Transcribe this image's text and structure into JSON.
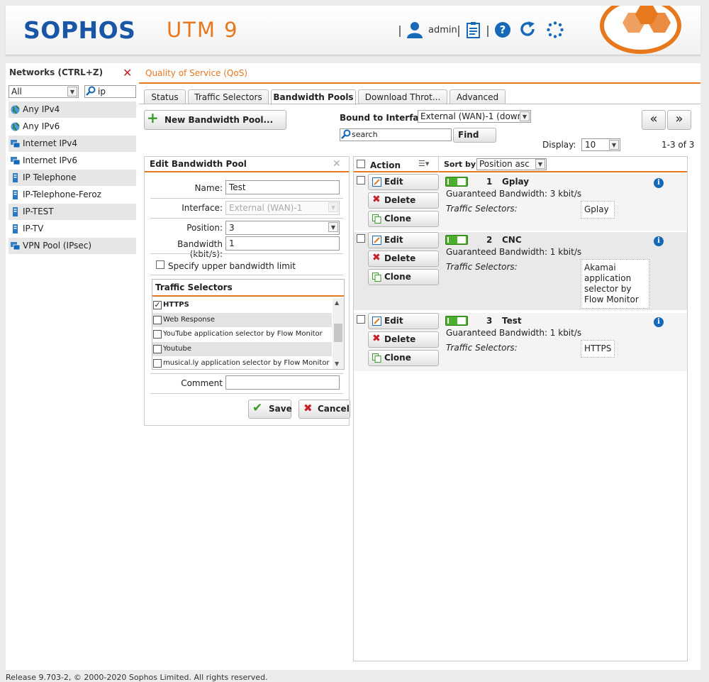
{
  "header": {
    "logo": "SOPHOS",
    "product": "UTM 9",
    "user": "admin",
    "help": "?"
  },
  "networks": {
    "title": "Networks (CTRL+Z)",
    "filter_value": "All",
    "search_value": "ip",
    "items": [
      {
        "label": "Any IPv4",
        "icon": "globe-icon"
      },
      {
        "label": "Any IPv6",
        "icon": "globe-icon"
      },
      {
        "label": "Internet IPv4",
        "icon": "network-icon"
      },
      {
        "label": "Internet IPv6",
        "icon": "network-icon"
      },
      {
        "label": "IP Telephone",
        "icon": "host-icon"
      },
      {
        "label": "IP-Telephone-Feroz",
        "icon": "host-icon"
      },
      {
        "label": "IP-TEST",
        "icon": "host-icon"
      },
      {
        "label": "IP-TV",
        "icon": "host-icon"
      },
      {
        "label": "VPN Pool (IPsec)",
        "icon": "network-icon"
      }
    ]
  },
  "breadcrumb": "Quality of Service (QoS)",
  "tabs": [
    "Status",
    "Traffic Selectors",
    "Bandwidth Pools",
    "Download Throt...",
    "Advanced"
  ],
  "toolbar": {
    "new_pool": "New Bandwidth Pool...",
    "bound_label": "Bound to Interface:",
    "bound_value": "External (WAN)-1 (down",
    "search_placeholder": "search",
    "find": "Find",
    "prev": "«",
    "next": "»",
    "display_label": "Display:",
    "display_value": "10",
    "count": "1-3 of 3"
  },
  "edit": {
    "title": "Edit Bandwidth Pool",
    "name_label": "Name:",
    "name_value": "Test",
    "interface_label": "Interface:",
    "interface_value": "External (WAN)-1",
    "position_label": "Position:",
    "position_value": "3",
    "bandwidth_label": "Bandwidth (kbit/s):",
    "bandwidth_value": "1",
    "upper_limit_label": "Specify upper bandwidth limit",
    "ts_title": "Traffic Selectors",
    "ts_items": [
      {
        "label": "HTTPS",
        "checked": true
      },
      {
        "label": "Web Response",
        "checked": false
      },
      {
        "label": "YouTube application selector by Flow Monitor",
        "checked": false
      },
      {
        "label": "Youtube",
        "checked": false
      },
      {
        "label": "musical.ly application selector by Flow Monitor",
        "checked": false
      }
    ],
    "comment_label": "Comment",
    "comment_value": "",
    "save": "Save",
    "cancel": "Cancel"
  },
  "list": {
    "action_header": "Action",
    "sort_label": "Sort by:",
    "sort_value": "Position asc",
    "edit_label": "Edit",
    "delete_label": "Delete",
    "clone_label": "Clone",
    "rows": [
      {
        "num": "1",
        "name": "Gplay",
        "bandwidth": "Guaranteed Bandwidth: 3 kbit/s",
        "ts_label": "Traffic Selectors:",
        "ts_value": "Gplay"
      },
      {
        "num": "2",
        "name": "CNC",
        "bandwidth": "Guaranteed Bandwidth: 1 kbit/s",
        "ts_label": "Traffic Selectors:",
        "ts_value": "Akamai application selector by Flow Monitor"
      },
      {
        "num": "3",
        "name": "Test",
        "bandwidth": "Guaranteed Bandwidth: 1 kbit/s",
        "ts_label": "Traffic Selectors:",
        "ts_value": "HTTPS"
      }
    ]
  },
  "footer": "Release 9.703-2, © 2000-2020 Sophos Limited. All rights reserved.",
  "colors": {
    "accent": "#e8781e",
    "brand_blue": "#1a56a6",
    "enabled_green": "#4caf2a"
  }
}
